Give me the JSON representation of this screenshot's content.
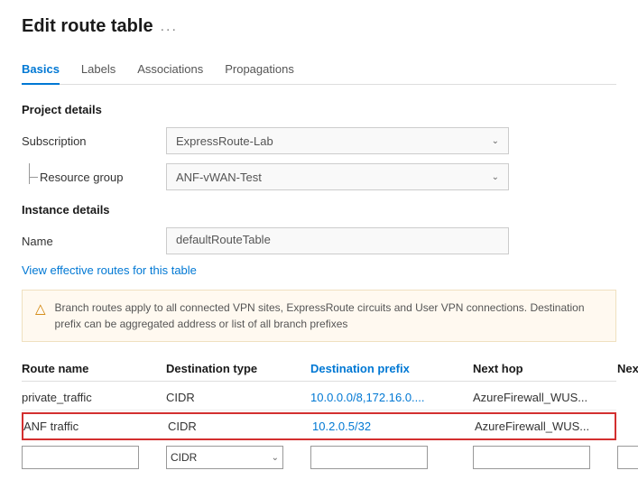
{
  "page": {
    "title": "Edit route table",
    "ellipsis": "...",
    "tabs": [
      {
        "id": "basics",
        "label": "Basics",
        "active": true
      },
      {
        "id": "labels",
        "label": "Labels",
        "active": false
      },
      {
        "id": "associations",
        "label": "Associations",
        "active": false
      },
      {
        "id": "propagations",
        "label": "Propagations",
        "active": false
      }
    ]
  },
  "form": {
    "project_details_title": "Project details",
    "subscription_label": "Subscription",
    "subscription_value": "ExpressRoute-Lab",
    "resource_group_label": "Resource group",
    "resource_group_value": "ANF-vWAN-Test",
    "instance_details_title": "Instance details",
    "name_label": "Name",
    "name_value": "defaultRouteTable",
    "view_routes_link": "View effective routes for this table"
  },
  "alert": {
    "text": "Branch routes apply to all connected VPN sites, ExpressRoute circuits and User VPN connections. Destination prefix can be aggregated address or list of all branch prefixes"
  },
  "table": {
    "headers": [
      {
        "id": "route-name",
        "label": "Route name",
        "type": "normal"
      },
      {
        "id": "destination-type",
        "label": "Destination type",
        "type": "normal"
      },
      {
        "id": "destination-prefix",
        "label": "Destination prefix",
        "type": "link"
      },
      {
        "id": "next-hop",
        "label": "Next hop",
        "type": "normal"
      },
      {
        "id": "next-hop-ip",
        "label": "Next Hop IP",
        "type": "normal"
      }
    ],
    "rows": [
      {
        "id": "row-1",
        "highlighted": false,
        "route_name": "private_traffic",
        "destination_type": "CIDR",
        "destination_prefix": "10.0.0.0/8,172.16.0....",
        "next_hop": "AzureFirewall_WUS...",
        "next_hop_ip": ""
      },
      {
        "id": "row-2",
        "highlighted": true,
        "route_name": "ANF traffic",
        "destination_type": "CIDR",
        "destination_prefix": "10.2.0.5/32",
        "next_hop": "AzureFirewall_WUS...",
        "next_hop_ip": ""
      }
    ],
    "new_row": {
      "route_name_placeholder": "",
      "destination_type_value": "CIDR",
      "destination_prefix_placeholder": "",
      "next_hop_placeholder": "",
      "next_hop_ip_placeholder": ""
    }
  }
}
